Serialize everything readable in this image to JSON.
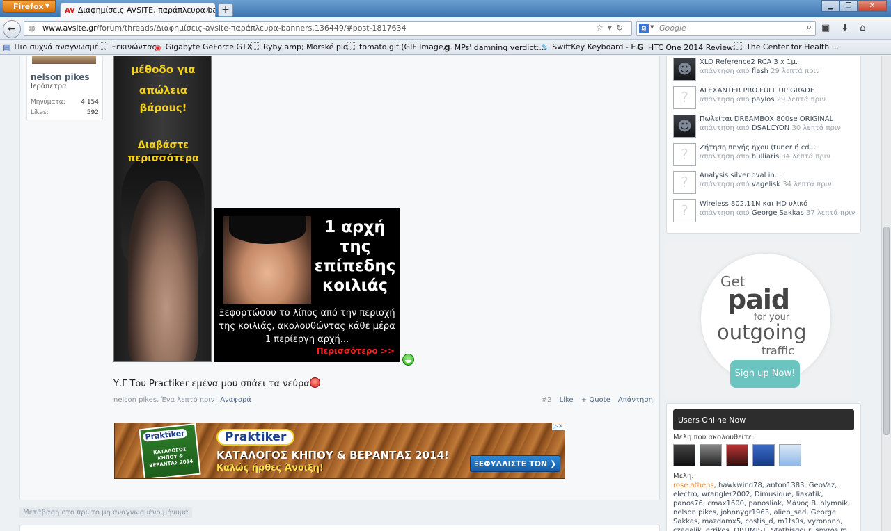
{
  "browser": {
    "menu_label": "Firefox",
    "tab_favicon": "AV",
    "tab_title": "Διαφημίσεις AVSITE, παράπλευρα bann...",
    "url_domain": "www.avsite.gr",
    "url_path": "/forum/threads/Διαφημίσεις-avsite-παράπλευρα-banners.136449/#post-1817634",
    "search_placeholder": "Google",
    "bookmarks": [
      "Πιο συχνά αναγνωσμέ...",
      "Ξεκινώντας",
      "Gigabyte GeForce GTX...",
      "Ryby amp; Morské plo...",
      "tomato.gif (GIF Image,...",
      "MPs' damning verdict:...",
      "SwiftKey Keyboard - E...",
      "HTC One 2014 Review:...",
      "The Center for Health ..."
    ]
  },
  "post": {
    "username": "nelson pikes",
    "location": "Ιεράπετρα",
    "stats": [
      {
        "label": "Μηνύματα:",
        "value": "4.154"
      },
      {
        "label": "Likes:",
        "value": "592"
      }
    ],
    "message": "Υ.Γ Του Practiker εμένα μου σπάει τα νεύρα",
    "meta_author_time": "nelson pikes, Ένα λεπτό πριν",
    "report_label": "Αναφορά",
    "post_number": "#2",
    "like_label": "Like",
    "quote_label": "+ Quote",
    "reply_label": "Απάντηση"
  },
  "ad_diet": {
    "line1": "μέθοδο για",
    "line2": "απώλεια βάρους!",
    "line3": "Διαβάστε",
    "line4": "περισσότερα"
  },
  "ad_belly": {
    "headline": [
      "1 αρχή",
      "της",
      "επίπεδης",
      "κοιλιάς"
    ],
    "body": "Ξεφορτώσου το λίπος από την περιοχή της κοιλιάς, ακολουθώντας κάθε μέρα 1 περίεργη αρχή...",
    "more": "Περισσότερο >>"
  },
  "ad_praktiker": {
    "book_logo": "Praktiker",
    "book_text": "ΚΑΤΑΛΟΓΟΣ ΚΗΠΟΥ & ΒΕΡΑΝΤΑΣ 2014",
    "logo": "Praktiker",
    "title": "ΚΑΤΑΛΟΓΟΣ ΚΗΠΟΥ & ΒΕΡΑΝΤΑΣ 2014!",
    "subtitle": "Καλώς ήρθες Άνοιξη!",
    "button": "ΞΕΦΥΛΛΙΣΤΕ ΤΟΝ ❯",
    "adchoices": "▷✕"
  },
  "jump_link": "Μετάβαση στο πρώτο μη αναγνωσμένο μήνυμα",
  "sidebar": {
    "reply_prefix": "απάντηση από",
    "threads": [
      {
        "title": "XLO Reference2 RCA 3 x 1μ.",
        "user": "flash",
        "time": "29 λεπτά πριν",
        "dark": true
      },
      {
        "title": "ALEXANTER PRO.FULL UP GRADE",
        "user": "paylos",
        "time": "29 λεπτά πριν",
        "dark": false
      },
      {
        "title": "Πωλείται DREAMBOX 800se ORIGINAL",
        "user": "DSALCYON",
        "time": "30 λεπτά πριν",
        "dark": true
      },
      {
        "title": "Ζήτηση πηγής ήχου (tuner ή cd...",
        "user": "hulliaris",
        "time": "34 λεπτά πριν",
        "dark": false
      },
      {
        "title": "Analysis silver oval in...",
        "user": "vagelisk",
        "time": "34 λεπτά πριν",
        "dark": false
      },
      {
        "title": "Wireless 802.11N και HD υλικό",
        "user": "George Sakkas",
        "time": "37 λεπτά πριν",
        "dark": false
      }
    ],
    "getpaid": {
      "l1": "Get",
      "l2": "paid",
      "l3": "for your",
      "l4": "outgoing",
      "l5": "traffic",
      "button": "Sign up Now!"
    },
    "online": {
      "title": "Users Online Now",
      "following_label": "Μέλη που ακολουθείτε:",
      "members_label": "Μέλη:",
      "highlight_member": "rose.athens",
      "members": ", hawkwind78, anton1383, GeoVaz, electro, wrangler2002, Dimusique, liakatik, panos76, cmax1600, panosliak, Μάνος.Β, olymnik, nelson pikes, johnnygr1963, alien_sad, George Sakkas, mazdamx5, costis_d, m1ts0s, vyronnnn, czagalik, errikos, OPTIMIST, Stathisgour, spyros m, ivres, geomiat, ARSENTI, iceland"
    }
  },
  "colors": {
    "ad_yellow": "#f5d21c",
    "ad_red": "#ff1e1e",
    "link_blue": "#4f6a86",
    "member_highlight": "#e8883a",
    "signup_teal": "#6bc4bf"
  }
}
